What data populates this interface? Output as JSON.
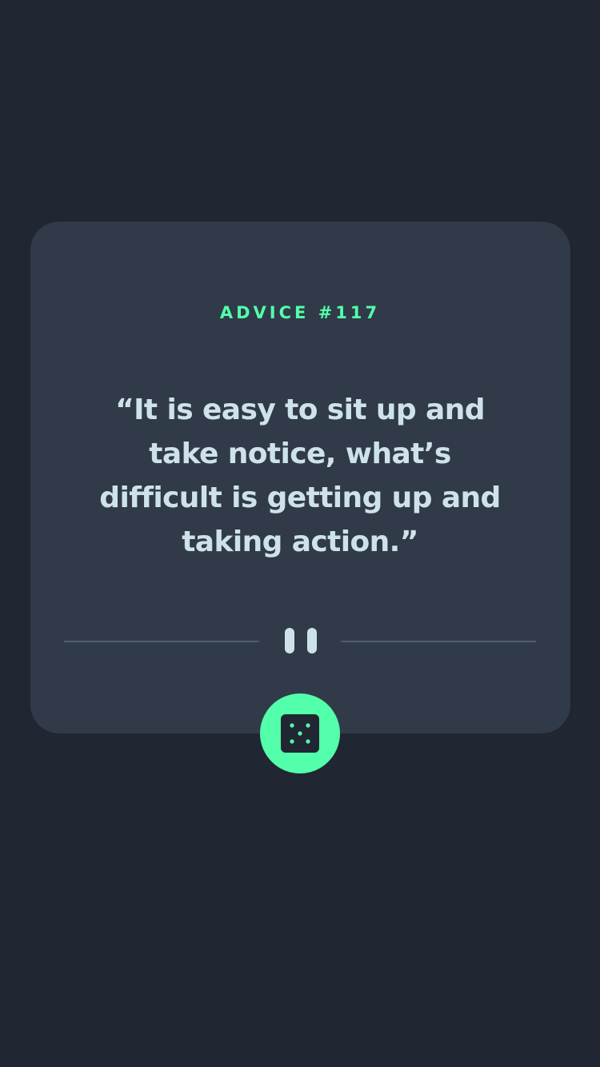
{
  "advice": {
    "label": "ADVICE #117",
    "quote": "“It is easy to sit up and take notice, what’s difficult is getting up and taking action.”"
  },
  "icons": {
    "divider": "pause-divider-icon",
    "button": "dice-icon"
  },
  "colors": {
    "background": "#202632",
    "card": "#313a49",
    "accent": "#53ffaa",
    "text": "#cee3e9",
    "divider_line": "#4f5d74"
  }
}
